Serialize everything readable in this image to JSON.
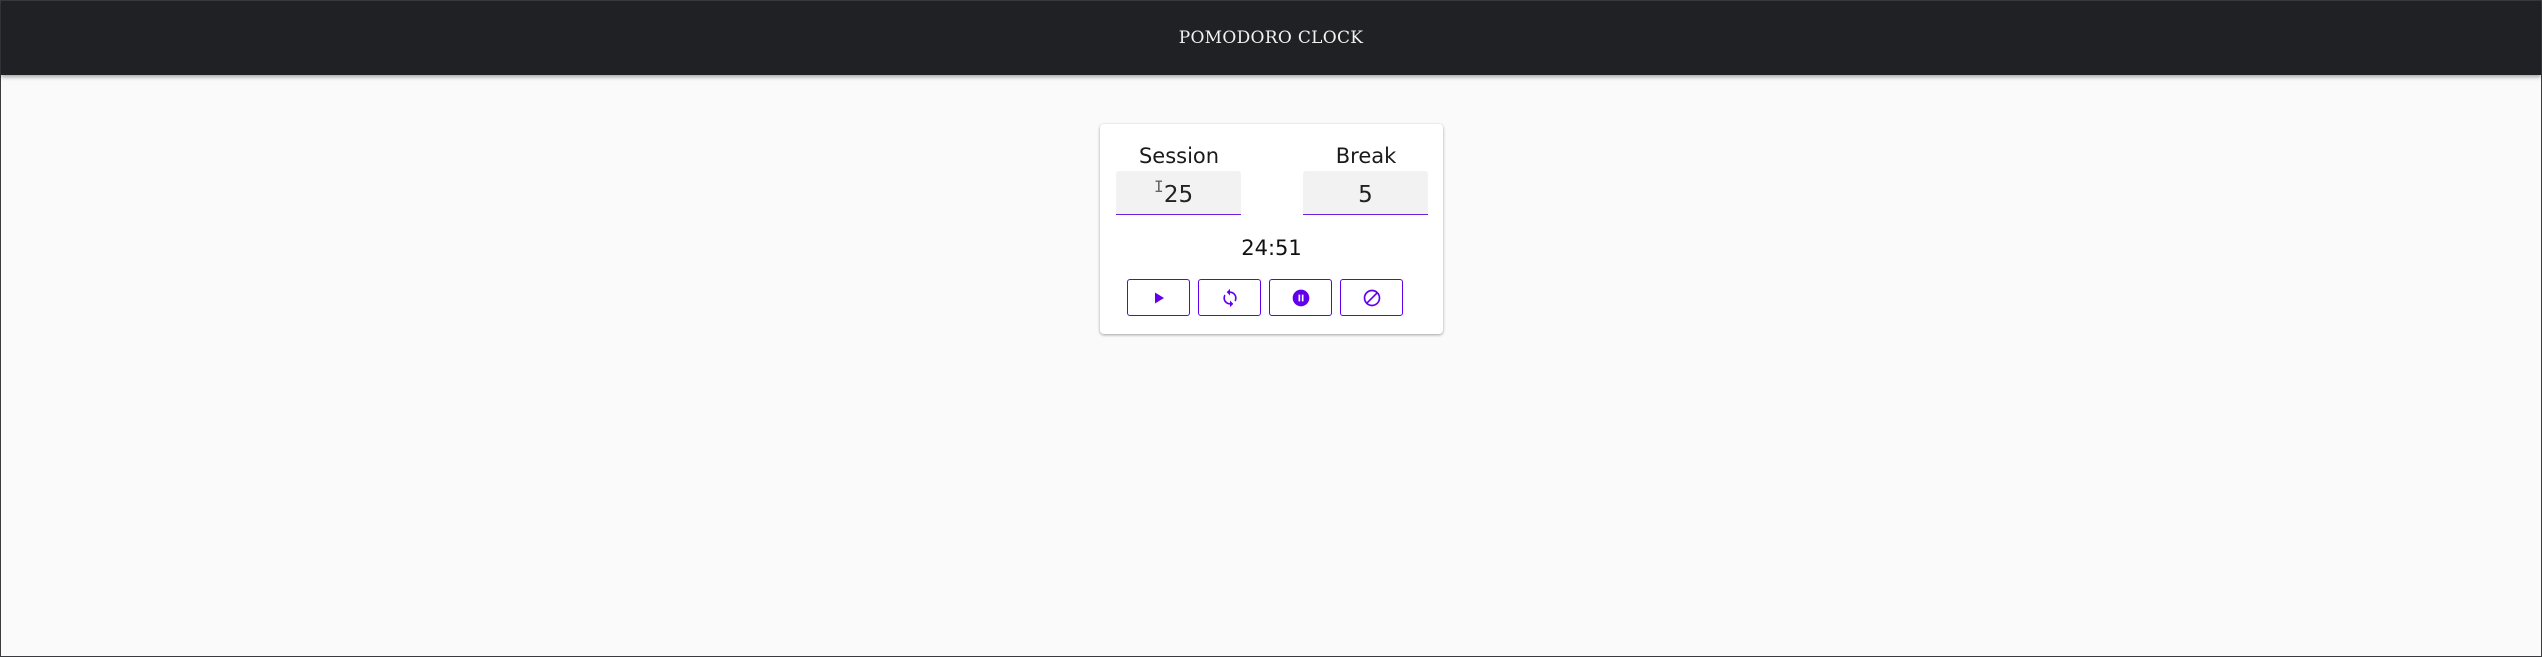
{
  "app": {
    "title": "POMODORO CLOCK"
  },
  "session": {
    "label": "Session",
    "value": "25"
  },
  "break": {
    "label": "Break",
    "value": "5"
  },
  "timer": {
    "display": "24:51"
  },
  "controls": [
    {
      "name": "play",
      "icon": "play-icon"
    },
    {
      "name": "restart",
      "icon": "refresh-icon"
    },
    {
      "name": "pause",
      "icon": "pause-circle-icon"
    },
    {
      "name": "stop",
      "icon": "block-icon"
    }
  ],
  "colors": {
    "appbar": "#202124",
    "accent": "#6200ee",
    "background": "#fafafa",
    "card": "#ffffff"
  }
}
